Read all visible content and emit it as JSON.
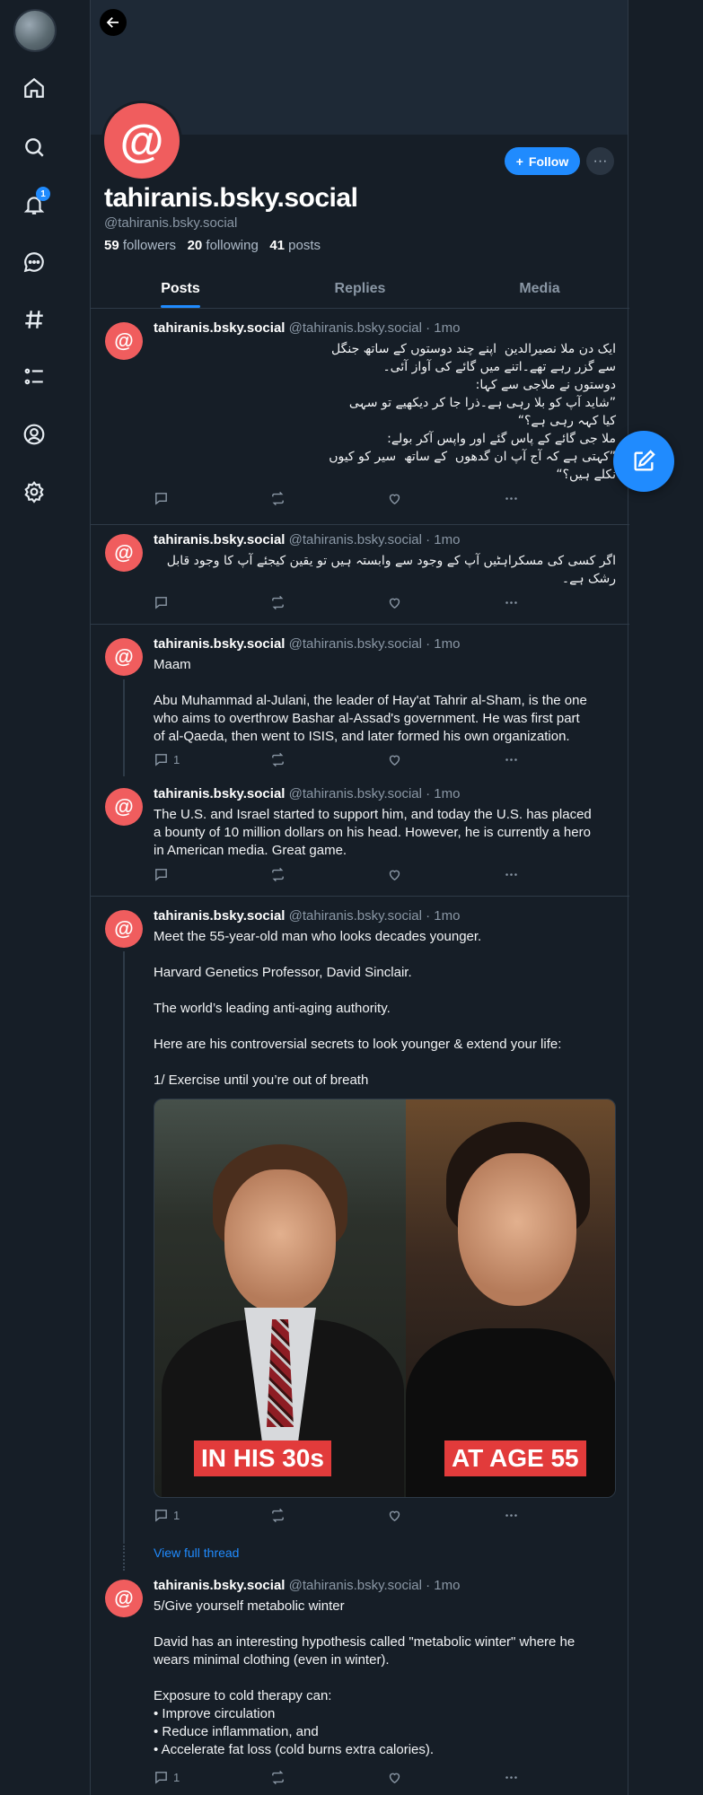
{
  "profile": {
    "display_name": "tahiranis.bsky.social",
    "handle": "@tahiranis.bsky.social",
    "followers_count": "59",
    "followers_label": "followers",
    "following_count": "20",
    "following_label": "following",
    "posts_count": "41",
    "posts_label": "posts",
    "follow_label": "Follow",
    "more_label": "···"
  },
  "sidebar": {
    "notification_badge": "1",
    "items": [
      "home-icon",
      "search-icon",
      "bell-icon",
      "chat-icon",
      "hashtag-icon",
      "list-icon",
      "profile-icon",
      "gear-icon"
    ]
  },
  "tabs": [
    {
      "label": "Posts",
      "active": true
    },
    {
      "label": "Replies",
      "active": false
    },
    {
      "label": "Media",
      "active": false
    }
  ],
  "posts": [
    {
      "author": "tahiranis.bsky.social",
      "meta": "@tahiranis.bsky.social · 1mo",
      "text": "ایک دن ملا نصیرالدین  اپنے چند دوستوں کے ساتھ جنگل\nسے گزر رہے تھے۔اتنے میں گائے کی آواز آئی۔\nدوستوں نے ملاجی سے کہا:\n”شاید آپ کو بلا رہی ہے۔ذرا جا کر دیکھیے تو سہی\nکیا کہہ رہی ہے؟“\nملا جی گائے کے پاس گئے اور واپس آکر بولے:\n”کہتی ہے کہ آج آپ ان گدھوں  کے ساتھ  سیر کو کیوں\nنکلے ہیں؟“",
      "replies": ""
    },
    {
      "author": "tahiranis.bsky.social",
      "meta": "@tahiranis.bsky.social · 1mo",
      "text": "اگر کسی کی مسکراہٹیں آپ کے وجود سے وابستہ ہیں تو یقین کیجئے آپ کا وجود قابل\nرشک ہے۔",
      "replies": ""
    },
    {
      "author": "tahiranis.bsky.social",
      "meta": "@tahiranis.bsky.social · 1mo",
      "text": "Maam\n\nAbu Muhammad al-Julani, the leader of Hay'at Tahrir al-Sham, is the one\nwho aims to overthrow Bashar al-Assad's government. He was first part\nof al-Qaeda, then went to ISIS, and later formed his own organization.",
      "replies": "1"
    },
    {
      "author": "tahiranis.bsky.social",
      "meta": "@tahiranis.bsky.social · 1mo",
      "text": "The U.S. and Israel started to support him, and today the U.S. has placed\na bounty of 10 million dollars on his head. However, he is currently a hero\nin American media. Great game.",
      "replies": ""
    },
    {
      "author": "tahiranis.bsky.social",
      "meta": "@tahiranis.bsky.social · 1mo",
      "text": "Meet the 55-year-old man who looks decades younger.\n\nHarvard Genetics Professor, David Sinclair.\n\nThe world’s leading anti-aging authority.\n\nHere are his controversial secrets to look younger & extend your life:\n\n1/ Exercise until you’re out of breath",
      "replies": "1",
      "image_captions": [
        "IN HIS 30s",
        "AT AGE 55"
      ]
    },
    {
      "author": "tahiranis.bsky.social",
      "meta": "@tahiranis.bsky.social · 1mo",
      "text": "5/Give yourself metabolic winter\n\nDavid has an interesting hypothesis called \"metabolic winter\" where he\nwears minimal clothing (even in winter).\n\nExposure to cold therapy can:\n• Improve circulation\n• Reduce inflammation, and\n• Accelerate fat loss (cold burns extra calories).",
      "replies": "1"
    }
  ],
  "view_full_thread": "View full thread",
  "colors": {
    "accent": "#208bfe",
    "avatar_bg": "#f05d5e",
    "background": "#161e27"
  }
}
